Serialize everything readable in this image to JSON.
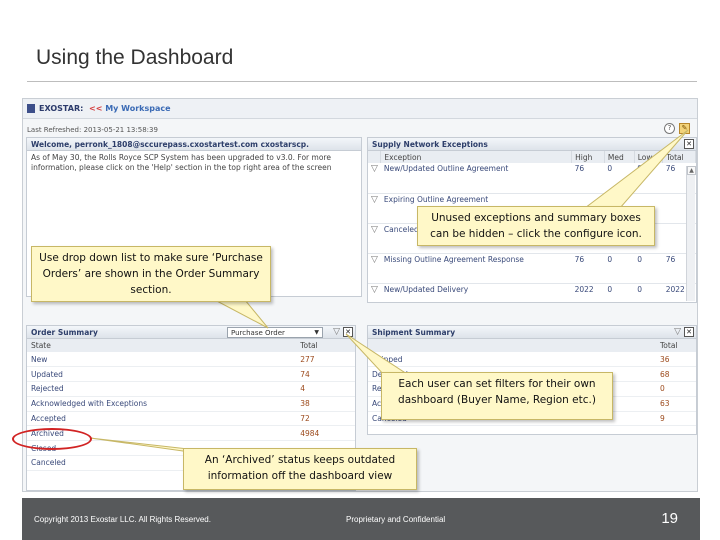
{
  "slide": {
    "title": "Using the Dashboard",
    "footer_copyright": "Copyright 2013 Exostar LLC. All Rights Reserved.",
    "footer_confidential": "Proprietary and Confidential",
    "page_number": "19"
  },
  "app": {
    "brand": "EXOSTAR:",
    "breadcrumb_sep": "<<",
    "breadcrumb_link": "My Workspace",
    "last_refreshed": "Last Refreshed: 2013-05-21 13:58:39"
  },
  "welcome_panel": {
    "title": "Welcome, perronk_1808@sccurepass.cxostartest.com cxostarscp.",
    "body": "As of May 30, the Rolls Royce SCP System has been upgraded to v3.0. For more information, please click on the 'Help' section in the top right area of the screen"
  },
  "supply_panel": {
    "title": "Supply Network Exceptions",
    "columns": [
      "Exception",
      "High",
      "Med",
      "Low",
      "Total"
    ],
    "rows": [
      {
        "exception": "New/Updated Outline Agreement",
        "high": "76",
        "med": "0",
        "low": "0",
        "total": "76"
      },
      {
        "exception": "Expiring Outline Agreement",
        "high": "",
        "med": "",
        "low": "",
        "total": ""
      },
      {
        "exception": "Canceled Outline Agreement",
        "high": "",
        "med": "",
        "low": "",
        "total": ""
      },
      {
        "exception": "Missing Outline Agreement Response",
        "high": "76",
        "med": "0",
        "low": "0",
        "total": "76"
      },
      {
        "exception": "New/Updated Delivery",
        "high": "2022",
        "med": "0",
        "low": "0",
        "total": "2022"
      }
    ]
  },
  "order_panel": {
    "title": "Order Summary",
    "select_value": "Purchase Order",
    "columns": [
      "State",
      "Total"
    ],
    "rows": [
      {
        "state": "New",
        "total": "277"
      },
      {
        "state": "Updated",
        "total": "74"
      },
      {
        "state": "Rejected",
        "total": "4"
      },
      {
        "state": "Acknowledged with Exceptions",
        "total": "38"
      },
      {
        "state": "Accepted",
        "total": "72"
      },
      {
        "state": "Archived",
        "total": "4984"
      },
      {
        "state": "Closed",
        "total": ""
      },
      {
        "state": "Canceled",
        "total": ""
      }
    ]
  },
  "shipment_panel": {
    "title": "Shipment Summary",
    "columns": [
      "",
      "Total"
    ],
    "rows": [
      {
        "state": "Shipped",
        "total": "36"
      },
      {
        "state": "Delivered",
        "total": "68"
      },
      {
        "state": "Received",
        "total": "0"
      },
      {
        "state": "Accepted",
        "total": "63"
      },
      {
        "state": "Canceled",
        "total": "9"
      }
    ]
  },
  "callouts": {
    "config": "Unused exceptions and summary boxes can be hidden – click the configure icon.",
    "dropdown": "Use drop down list to make sure ‘Purchase Orders’ are shown in the Order Summary section.",
    "filters": "Each user can set filters for their own dashboard (Buyer Name, Region etc.)",
    "archived": "An ‘Archived’ status keeps outdated information off the dashboard view"
  },
  "colors": {
    "footer_bg": "#57595b",
    "callout_bg": "#fff8c8",
    "highlight_oval": "#d12323",
    "panel_title": "#2d3e6a"
  },
  "icons": [
    "help-icon",
    "configure-icon",
    "close-icon",
    "filter-icon",
    "dropdown-arrow-icon"
  ]
}
